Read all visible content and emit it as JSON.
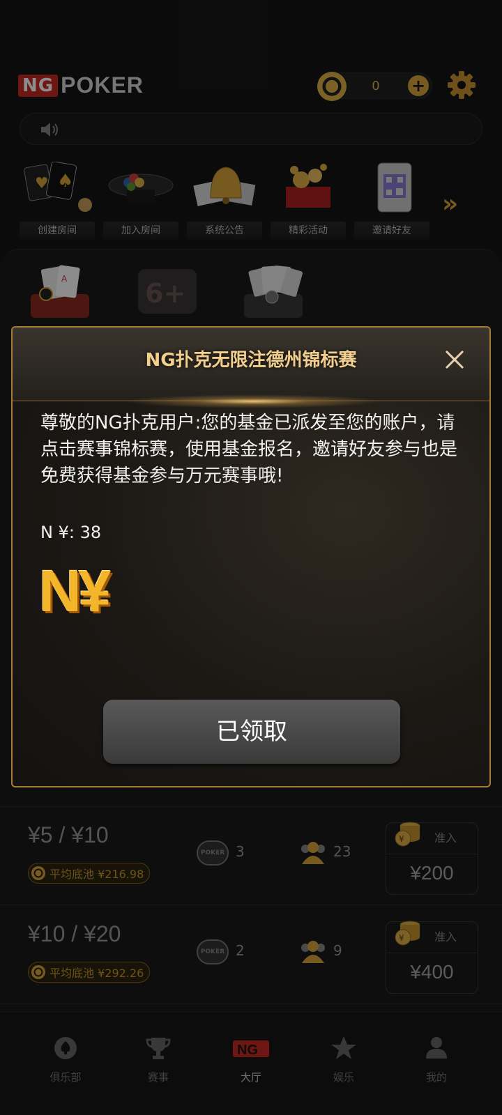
{
  "header": {
    "logo_ng": "NG",
    "logo_poker": "POKER",
    "coins": "0"
  },
  "menu": [
    {
      "label": "创建房间",
      "icon": "create-room-cards"
    },
    {
      "label": "加入房间",
      "icon": "poker-table"
    },
    {
      "label": "系统公告",
      "icon": "bell"
    },
    {
      "label": "精彩活动",
      "icon": "gift-coins"
    },
    {
      "label": "邀请好友",
      "icon": "qr-code-phone"
    }
  ],
  "tables": [
    {
      "blinds": "¥5 / ¥10",
      "avg_pot": "平均底池 ¥216.98",
      "tables": "3",
      "players": "23",
      "buyin_label": "准入",
      "buyin": "¥200"
    },
    {
      "blinds": "¥10 / ¥20",
      "avg_pot": "平均底池 ¥292.26",
      "tables": "2",
      "players": "9",
      "buyin_label": "准入",
      "buyin": "¥400"
    }
  ],
  "nav": [
    {
      "label": "俱乐部",
      "icon": "club-icon"
    },
    {
      "label": "赛事",
      "icon": "trophy-icon"
    },
    {
      "label": "大厅",
      "icon": "ng-logo-icon"
    },
    {
      "label": "娱乐",
      "icon": "star-icon"
    },
    {
      "label": "我的",
      "icon": "profile-icon"
    }
  ],
  "dialog": {
    "title": "NG扑克无限注德州锦标赛",
    "body": "尊敬的NG扑克用户:您的基金已派发至您的账户，请点击赛事锦标赛，使用基金报名，邀请好友参与也是免费获得基金参与万元赛事哦!",
    "amount": "N ¥: 38",
    "logo": "N¥",
    "button": "已领取"
  },
  "colors": {
    "accent_gold": "#d9a53a",
    "brand_red": "#c8291f",
    "background": "#141414"
  }
}
